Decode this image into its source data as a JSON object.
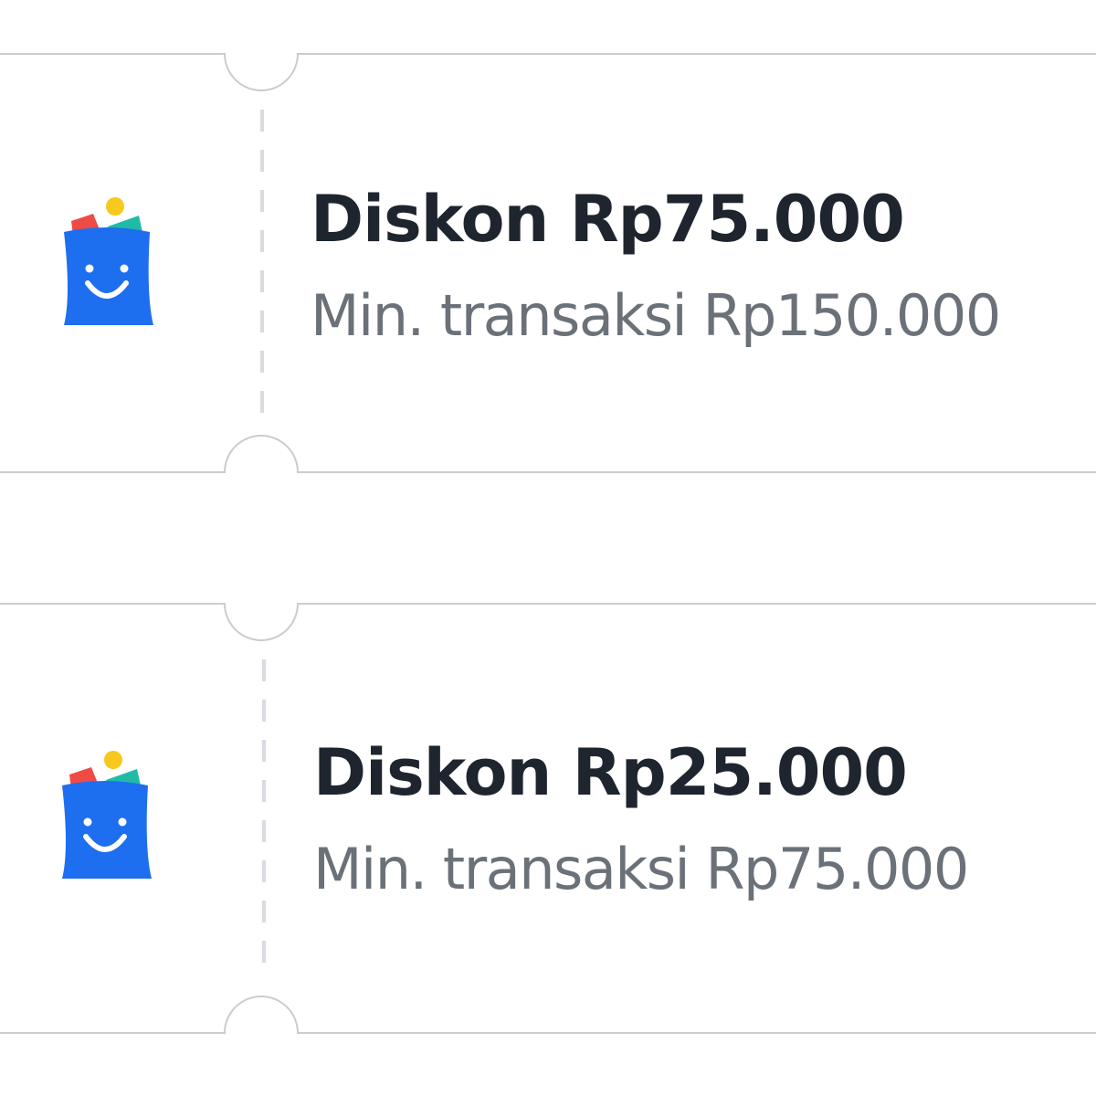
{
  "colors": {
    "title": "#1e252e",
    "subtitle": "#6b7178",
    "ticket_border": "#c9ccd1",
    "divider_dash": "#d8dbe0",
    "logo_bag": "#1e6ef0",
    "logo_red": "#ee4b45",
    "logo_yellow": "#f7c91c",
    "logo_teal": "#1fbba6"
  },
  "vouchers": [
    {
      "icon": "shopping-bag-smile-logo",
      "title": "Diskon Rp75.000",
      "subtitle": "Min. transaksi Rp150.000"
    },
    {
      "icon": "shopping-bag-smile-logo",
      "title": "Diskon Rp25.000",
      "subtitle": "Min. transaksi Rp75.000"
    }
  ]
}
